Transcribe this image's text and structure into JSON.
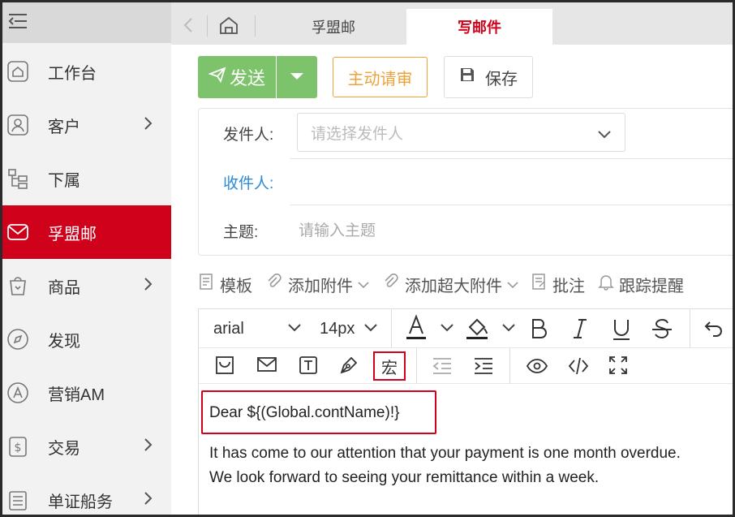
{
  "sidebar": {
    "items": [
      {
        "label": "工作台",
        "icon": "home-icon",
        "chevron": false
      },
      {
        "label": "客户",
        "icon": "customer-icon",
        "chevron": true
      },
      {
        "label": "下属",
        "icon": "org-chart-icon",
        "chevron": false
      },
      {
        "label": "孚盟邮",
        "icon": "mail-icon",
        "chevron": false,
        "active": true
      },
      {
        "label": "商品",
        "icon": "product-bag-icon",
        "chevron": true
      },
      {
        "label": "发现",
        "icon": "compass-icon",
        "chevron": false
      },
      {
        "label": "营销AM",
        "icon": "am-circle-icon",
        "chevron": false
      },
      {
        "label": "交易",
        "icon": "dollar-doc-icon",
        "chevron": true
      },
      {
        "label": "单证船务",
        "icon": "document-icon",
        "chevron": true
      }
    ]
  },
  "tabs": [
    {
      "label": "孚盟邮"
    },
    {
      "label": "写邮件",
      "active": true
    }
  ],
  "toolbar": {
    "send_label": "发送",
    "review_label": "主动请审",
    "save_label": "保存"
  },
  "form": {
    "sender_label": "发件人:",
    "sender_placeholder": "请选择发件人",
    "recipient_label": "收件人:",
    "subject_label": "主题:",
    "subject_placeholder": "请输入主题"
  },
  "attachments": {
    "template": "模板",
    "add_attachment": "添加附件",
    "add_large_attachment": "添加超大附件",
    "annotate": "批注",
    "track_reminder": "跟踪提醒"
  },
  "editor": {
    "font_family": "arial",
    "font_size": "14px",
    "macro_label": "宏",
    "body": {
      "greeting": "Dear ${(Global.contName)!}",
      "line1": "It has come to our attention that your payment is one month overdue.",
      "line2": "We look forward to seeing your remittance within a week."
    }
  },
  "colors": {
    "accent_red": "#d0021b",
    "send_green": "#7dc36b",
    "review_orange": "#f0a23a",
    "link_blue": "#2b8ad8"
  }
}
